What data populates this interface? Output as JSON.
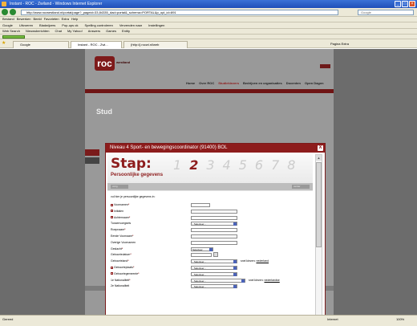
{
  "browser": {
    "title": "Instant - ROC - Zwiland - Windows Internet Explorer",
    "url": "http://www.rocwestland.nl/portal/page?_pageid=33,84335_dad=portal&_schema=PORTAL&p_opl_id=891",
    "search_placeholder": "Google",
    "menu": [
      "Bestand",
      "Bewerken",
      "Beeld",
      "Favorieten",
      "Extra",
      "Help"
    ],
    "gbar": [
      "Google",
      "Uitvoeren",
      "Bladwijzers",
      "Pop-ups ok",
      "Spelling controleren",
      "Verzenden naar",
      "Instellingen"
    ],
    "links": [
      "Web Search",
      "Nieuwsberichten",
      "Chat",
      "My Yahoo!",
      "Answers",
      "Games",
      "Entity"
    ],
    "tabs": [
      "Google",
      "Instant - ROC - Zwi...",
      "(http://j.rocwi.nl/web"
    ],
    "cmd": [
      "Pagina",
      "Extra"
    ],
    "status": "Gereed",
    "zone": "Internet",
    "zoom": "100%"
  },
  "site": {
    "logo": "roc",
    "brand": "westland",
    "nav": [
      "Home",
      "Over ROC",
      "Studiekiezers",
      "Bedrijven en organisaties",
      "Docenten",
      "Open Dagen"
    ],
    "studi": "Stud"
  },
  "modal": {
    "title": "Niveau 4 Sport- en bewegingscoordinator (91400) BOL",
    "close": "X",
    "stap": "Stap:",
    "subtitle": "Persoonlijke gegevens",
    "steps": [
      "1",
      "2",
      "3",
      "4",
      "5",
      "6",
      "7",
      "8"
    ],
    "current_step": 2,
    "prev": "vorig",
    "next": "verder",
    "intro": "vul hier je persoonlijke gegevens in:",
    "fields": [
      {
        "label": "Voornamen",
        "req": true,
        "help": true,
        "type": "input"
      },
      {
        "label": "Initialen",
        "req": false,
        "help": true,
        "type": "input"
      },
      {
        "label": "Achternaam",
        "req": true,
        "help": true,
        "type": "input"
      },
      {
        "label": "Tussenvoegsels",
        "req": false,
        "help": false,
        "type": "select",
        "value": "- Selecteer -"
      },
      {
        "label": "Roepnaam",
        "req": true,
        "help": false,
        "type": "input"
      },
      {
        "label": "Eerste Voornaam",
        "req": true,
        "help": false,
        "type": "input"
      },
      {
        "label": "Overige Voornamen",
        "req": false,
        "help": false,
        "type": "input"
      },
      {
        "label": "Geslacht",
        "req": true,
        "help": false,
        "type": "select",
        "value": "Selecteer"
      },
      {
        "label": "Geboortedatum",
        "req": true,
        "help": false,
        "type": "date"
      },
      {
        "label": "Geboorteland",
        "req": true,
        "help": false,
        "type": "select",
        "value": "- Selecteer -",
        "extra": "snel kiezen:",
        "link": "nederland"
      },
      {
        "label": "Geboorteplaats",
        "req": true,
        "help": true,
        "type": "select",
        "value": "- Selecteer -"
      },
      {
        "label": "Geboortegemeente",
        "req": true,
        "help": true,
        "type": "select",
        "value": "- Selecteer -"
      },
      {
        "label": "1e Nationaliteit",
        "req": true,
        "help": false,
        "type": "select",
        "value": "- Selecteer -",
        "extra": "snel kiezen:",
        "link": "nederlandse"
      },
      {
        "label": "2e Nationaliteit",
        "req": false,
        "help": false,
        "type": "select",
        "value": "- Selecteer -"
      }
    ]
  }
}
